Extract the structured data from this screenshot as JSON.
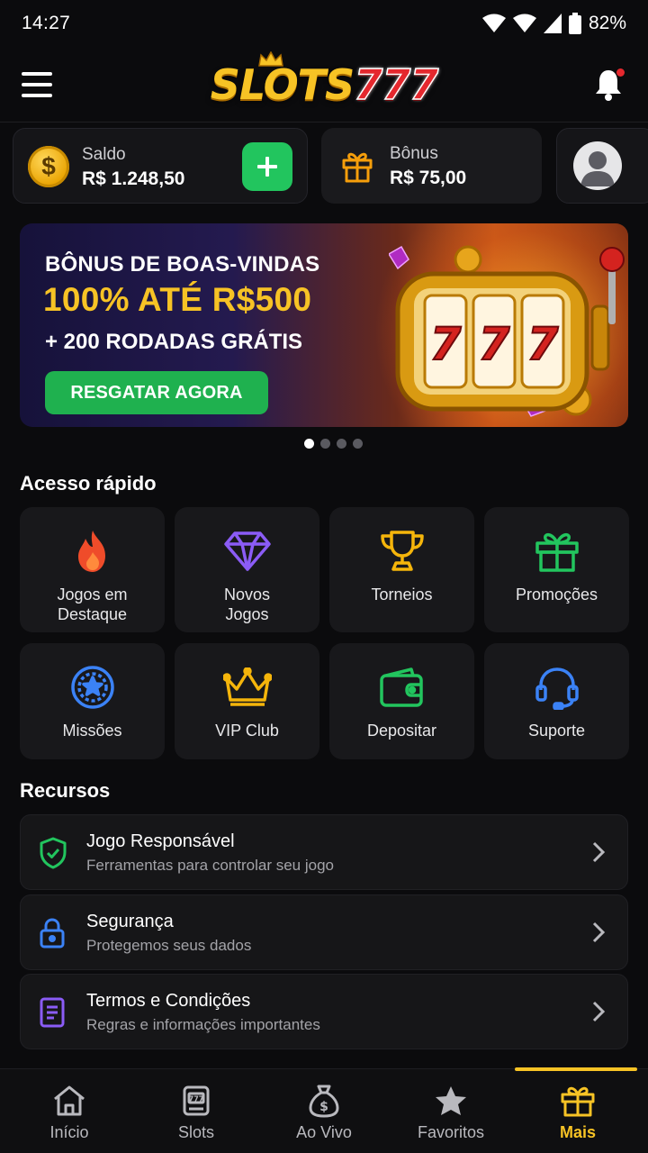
{
  "status_bar": {
    "time": "14:27",
    "battery": "82%"
  },
  "header": {
    "logo_slots": "SLOTS",
    "logo_num": "777"
  },
  "wallet": {
    "balance_label": "Saldo",
    "balance_value": "R$ 1.248,50",
    "bonus_label": "Bônus",
    "bonus_value": "R$ 75,00"
  },
  "banner": {
    "line1": "BÔNUS DE BOAS-VINDAS",
    "line2": "100% ATÉ R$500",
    "line3": "+ 200 RODADAS GRÁTIS",
    "cta": "RESGATAR AGORA",
    "slides": 4,
    "active_slide": 1
  },
  "quick_access": {
    "title": "Acesso rápido",
    "items": [
      {
        "label": "Jogos em\nDestaque",
        "icon": "flame-icon",
        "color": "#ef4c2a"
      },
      {
        "label": "Novos\nJogos",
        "icon": "diamond-icon",
        "color": "#8b5cf6"
      },
      {
        "label": "Torneios",
        "icon": "trophy-icon",
        "color": "#f5b50b"
      },
      {
        "label": "Promoções",
        "icon": "gift-icon",
        "color": "#22c55e"
      },
      {
        "label": "Missões",
        "icon": "star-badge-icon",
        "color": "#3b82f6"
      },
      {
        "label": "VIP Club",
        "icon": "crown-icon",
        "color": "#f5b50b"
      },
      {
        "label": "Depositar",
        "icon": "wallet-icon",
        "color": "#22c55e"
      },
      {
        "label": "Suporte",
        "icon": "headset-icon",
        "color": "#3b82f6"
      }
    ]
  },
  "resources": {
    "title": "Recursos",
    "items": [
      {
        "title": "Jogo Responsável",
        "subtitle": "Ferramentas para controlar seu jogo",
        "icon": "shield-check-icon",
        "color": "#22c55e"
      },
      {
        "title": "Segurança",
        "subtitle": "Protegemos seus dados",
        "icon": "lock-icon",
        "color": "#3b82f6"
      },
      {
        "title": "Termos e Condições",
        "subtitle": "Regras e informações importantes",
        "icon": "document-icon",
        "color": "#8b5cf6"
      }
    ]
  },
  "bottom_nav": {
    "items": [
      {
        "label": "Início",
        "icon": "home-icon"
      },
      {
        "label": "Slots",
        "icon": "slot-machine-icon"
      },
      {
        "label": "Ao Vivo",
        "icon": "money-bag-icon"
      },
      {
        "label": "Favoritos",
        "icon": "star-icon"
      },
      {
        "label": "Mais",
        "icon": "gift-icon"
      }
    ],
    "active": "Mais",
    "accent": "#f7c325"
  }
}
